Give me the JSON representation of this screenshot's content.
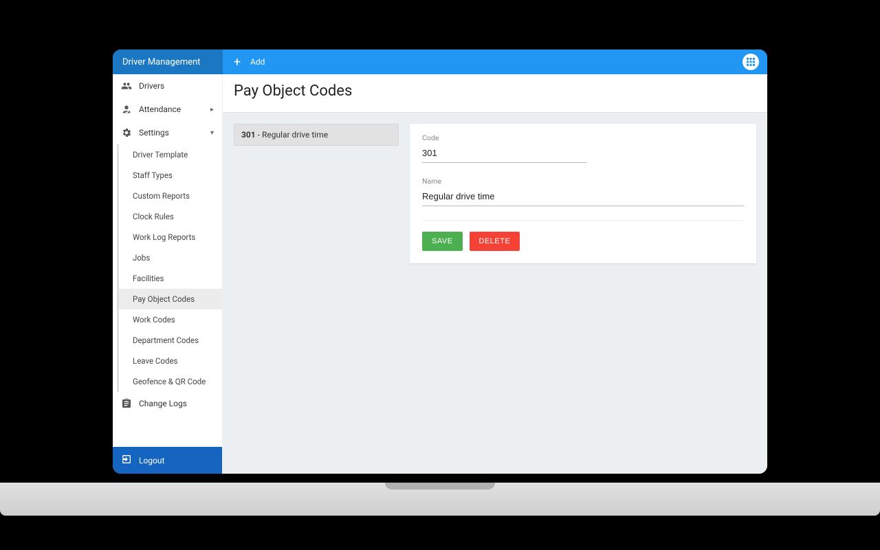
{
  "brand": "Driver Management",
  "toolbar": {
    "add_label": "Add"
  },
  "sidebar": {
    "drivers": "Drivers",
    "attendance": "Attendance",
    "settings": "Settings",
    "settings_items": [
      "Driver Template",
      "Staff Types",
      "Custom Reports",
      "Clock Rules",
      "Work Log Reports",
      "Jobs",
      "Facilities",
      "Pay Object Codes",
      "Work Codes",
      "Department Codes",
      "Leave Codes",
      "Geofence & QR Code"
    ],
    "change_logs": "Change Logs",
    "logout": "Logout"
  },
  "page": {
    "title": "Pay Object Codes"
  },
  "list": {
    "items": [
      {
        "code": "301",
        "sep": " - ",
        "name": "Regular drive time"
      }
    ]
  },
  "form": {
    "code_label": "Code",
    "code_value": "301",
    "name_label": "Name",
    "name_value": "Regular drive time",
    "save_label": "Save",
    "delete_label": "Delete"
  }
}
